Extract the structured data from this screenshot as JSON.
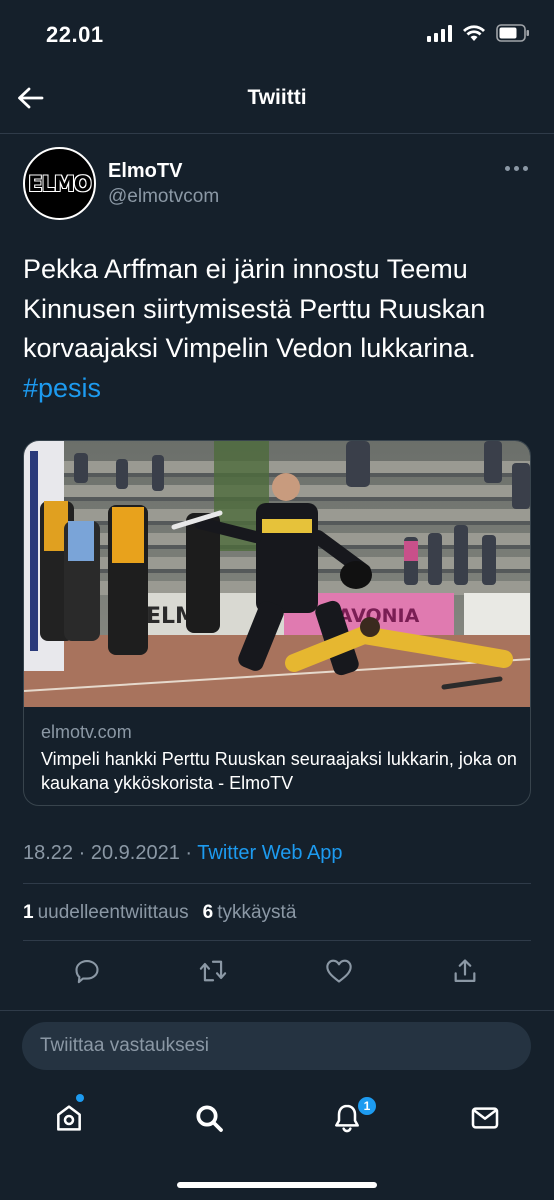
{
  "status_bar": {
    "time": "22.01"
  },
  "header": {
    "title": "Twiitti"
  },
  "author": {
    "name": "ElmoTV",
    "handle": "@elmotvcom",
    "avatar_text": "ELMO"
  },
  "tweet": {
    "text": "Pekka Arffman ei järin innostu Teemu Kinnusen siirtymisestä Perttu Ruuskan korvaajaksi Vimpelin Vedon lukkarina.",
    "hashtag": "#pesis"
  },
  "card": {
    "domain": "elmotv.com",
    "title": "Vimpeli hankki Perttu Ruuskan seuraajaksi lukkarin, joka on kaukana ykköskorista - ElmoTV",
    "image_banner_left": "ELMA",
    "image_banner_right": "SAVONIA"
  },
  "meta": {
    "time": "18.22",
    "date": "20.9.2021",
    "separator": "·",
    "app": "Twitter Web App"
  },
  "stats": {
    "retweets_count": "1",
    "retweets_label": "uudelleentwiittaus",
    "likes_count": "6",
    "likes_label": "tykkäystä"
  },
  "actions": [
    "reply-icon",
    "retweet-icon",
    "like-icon",
    "share-icon"
  ],
  "reply": {
    "placeholder": "Twiittaa vastauksesi"
  },
  "nav": {
    "items": [
      "home-icon",
      "search-icon",
      "notifications-icon",
      "messages-icon"
    ],
    "notifications_badge": "1"
  },
  "colors": {
    "background": "#15202b",
    "accent": "#1d9bf0",
    "muted": "#8b98a5",
    "divider": "#2f3b49"
  }
}
